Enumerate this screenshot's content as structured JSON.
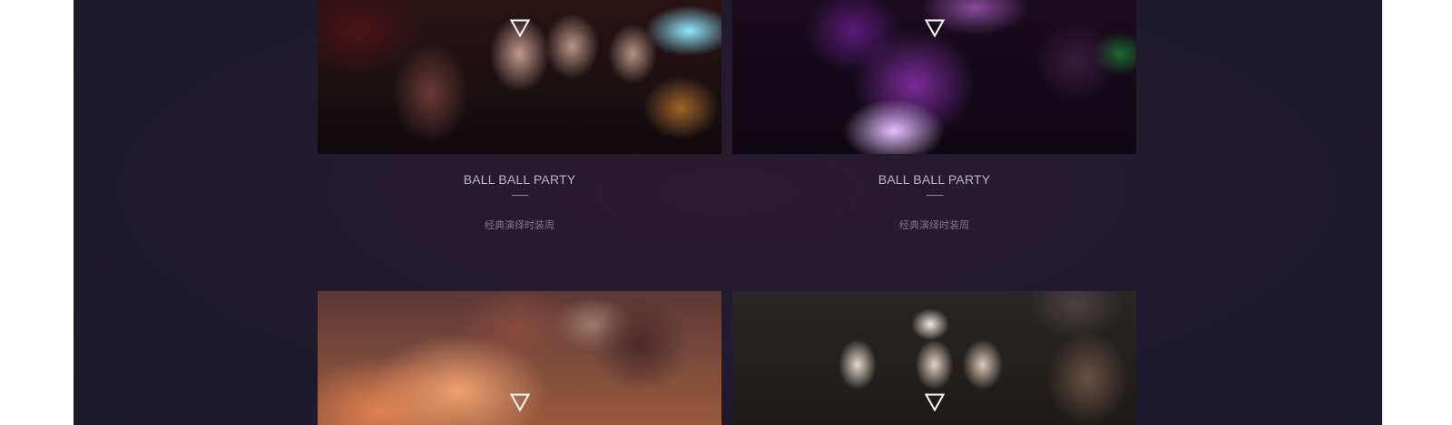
{
  "cards": [
    {
      "title": "BALL BALL PARTY",
      "subtitle": "经典演绎时装周",
      "photo_alt": "club-crowd-photo"
    },
    {
      "title": "BALL BALL PARTY",
      "subtitle": "经典演绎时装周",
      "photo_alt": "dance-floor-photo"
    },
    {
      "photo_alt": "stage-haze-photo"
    },
    {
      "photo_alt": "sepia-portrait-photo"
    }
  ],
  "colors": {
    "panel_background": "#1d1a2c",
    "title_text": "#b9b6bf",
    "subtitle_text": "#7e7886",
    "page_background": "#ffffff"
  },
  "icons": {
    "card_marker": "triangle-down-outline-icon"
  }
}
